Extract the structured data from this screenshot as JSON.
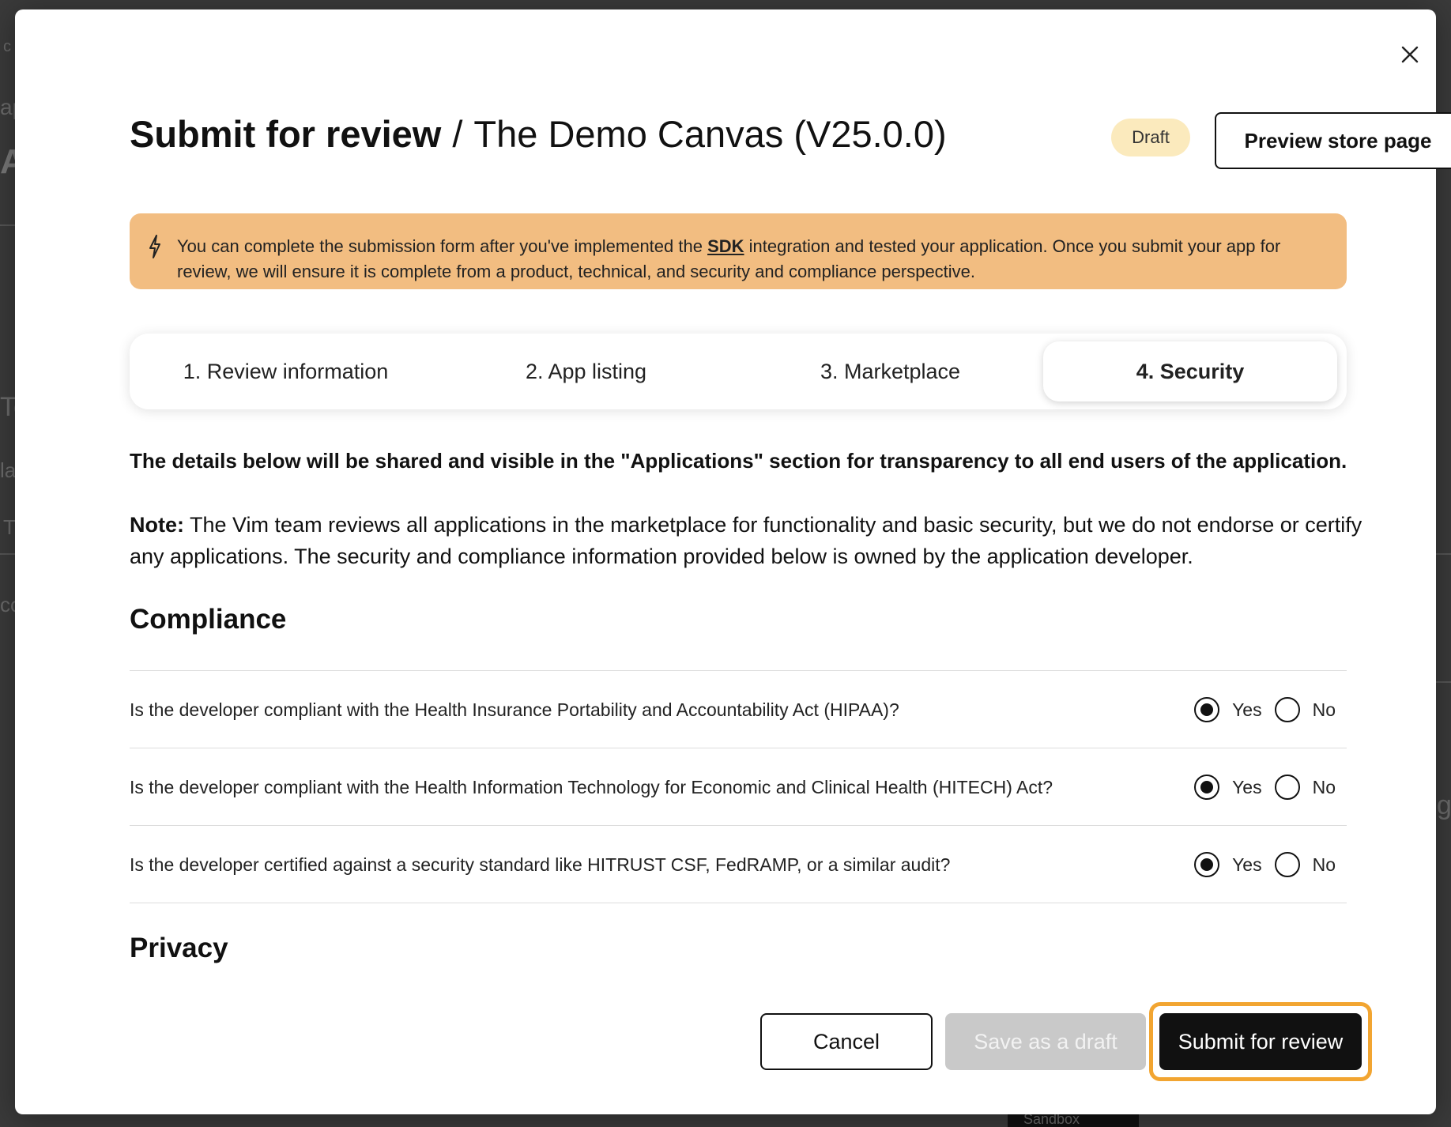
{
  "background": {
    "fragments": [
      "c",
      "ap",
      "A",
      "Te",
      "la",
      "T",
      "co",
      "g"
    ],
    "sandbox_label": "Sandbox"
  },
  "modal": {
    "close_icon": "close-icon",
    "title": "Submit for review",
    "separator": "/",
    "app_name": "The Demo Canvas (V25.0.0)",
    "status_badge": "Draft",
    "preview_button": "Preview store page"
  },
  "banner": {
    "icon": "lightning-icon",
    "text_before": "You can complete the submission form after you've implemented the ",
    "link": "SDK",
    "text_after": " integration and tested your application. Once you submit your app for review, we will ensure it is complete from a product, technical, and security and compliance perspective.",
    "color": "#f2bd81"
  },
  "tabs": [
    {
      "label": "1. Review information",
      "active": false
    },
    {
      "label": "2. App listing",
      "active": false
    },
    {
      "label": "3. Marketplace",
      "active": false
    },
    {
      "label": "4. Security",
      "active": true
    }
  ],
  "intro": "The details below will be shared and visible in the \"Applications\" section for transparency to all end users of the application.",
  "note": {
    "label": "Note:",
    "text": " The Vim team reviews all applications in the marketplace for functionality and basic security, but we do not endorse or certify any applications. The security and compliance information provided below is owned by the application developer."
  },
  "compliance": {
    "heading": "Compliance",
    "questions": [
      {
        "text": "Is the developer compliant with the Health Insurance Portability and Accountability Act (HIPAA)?",
        "yes": "Yes",
        "no": "No",
        "selected": "Yes"
      },
      {
        "text": "Is the developer compliant with the Health Information Technology for Economic and Clinical Health (HITECH) Act?",
        "yes": "Yes",
        "no": "No",
        "selected": "Yes"
      },
      {
        "text": "Is the developer certified against a security standard like HITRUST CSF, FedRAMP, or a similar audit?",
        "yes": "Yes",
        "no": "No",
        "selected": "Yes"
      }
    ]
  },
  "privacy": {
    "heading": "Privacy"
  },
  "footer": {
    "cancel": "Cancel",
    "save_draft": "Save as a draft",
    "submit": "Submit for review",
    "focus_ring_color": "#f2a531"
  }
}
